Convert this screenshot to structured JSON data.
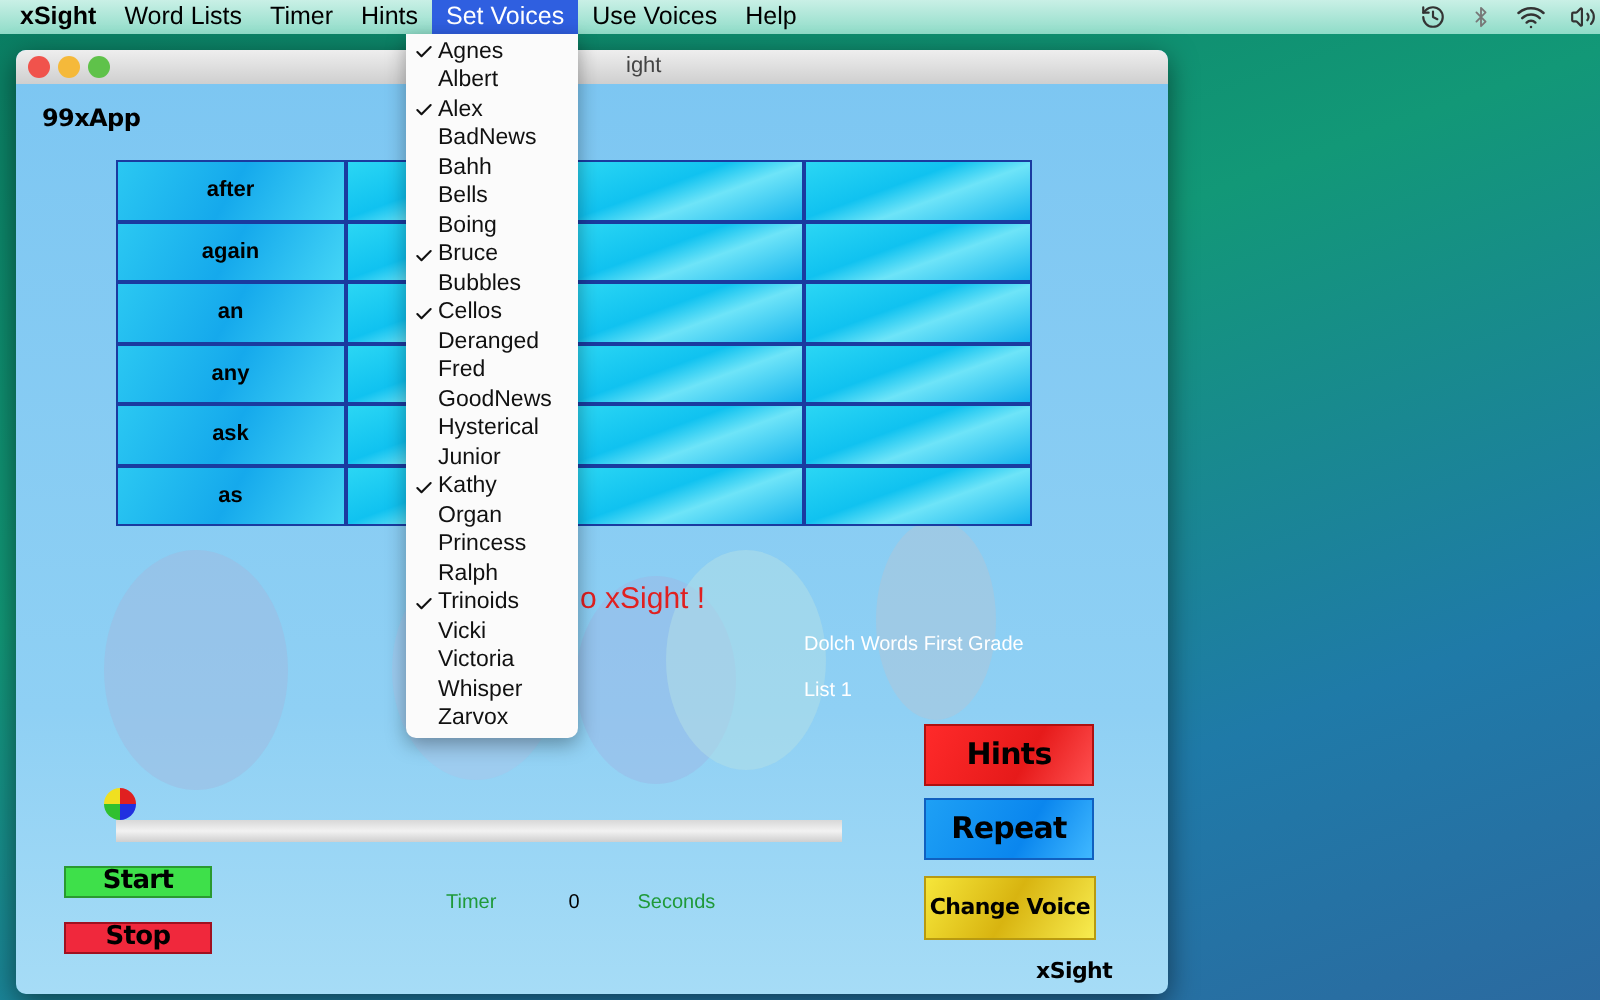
{
  "menu_bar": {
    "items": [
      {
        "label": "xSight",
        "selected": false,
        "kind": "app"
      },
      {
        "label": "Word Lists",
        "selected": false,
        "kind": "menu"
      },
      {
        "label": "Timer",
        "selected": false,
        "kind": "menu"
      },
      {
        "label": "Hints",
        "selected": false,
        "kind": "menu"
      },
      {
        "label": "Set Voices",
        "selected": true,
        "kind": "menu"
      },
      {
        "label": "Use Voices",
        "selected": false,
        "kind": "menu"
      },
      {
        "label": "Help",
        "selected": false,
        "kind": "menu"
      }
    ]
  },
  "voices_menu": {
    "items": [
      {
        "label": "Agnes",
        "checked": true
      },
      {
        "label": "Albert",
        "checked": false
      },
      {
        "label": "Alex",
        "checked": true
      },
      {
        "label": "BadNews",
        "checked": false
      },
      {
        "label": "Bahh",
        "checked": false
      },
      {
        "label": "Bells",
        "checked": false
      },
      {
        "label": "Boing",
        "checked": false
      },
      {
        "label": "Bruce",
        "checked": true
      },
      {
        "label": "Bubbles",
        "checked": false
      },
      {
        "label": "Cellos",
        "checked": true
      },
      {
        "label": "Deranged",
        "checked": false
      },
      {
        "label": "Fred",
        "checked": false
      },
      {
        "label": "GoodNews",
        "checked": false
      },
      {
        "label": "Hysterical",
        "checked": false
      },
      {
        "label": "Junior",
        "checked": false
      },
      {
        "label": "Kathy",
        "checked": true
      },
      {
        "label": "Organ",
        "checked": false
      },
      {
        "label": "Princess",
        "checked": false
      },
      {
        "label": "Ralph",
        "checked": false
      },
      {
        "label": "Trinoids",
        "checked": true
      },
      {
        "label": "Vicki",
        "checked": false
      },
      {
        "label": "Victoria",
        "checked": false
      },
      {
        "label": "Whisper",
        "checked": false
      },
      {
        "label": "Zarvox",
        "checked": false
      }
    ]
  },
  "window": {
    "title": "ight",
    "brand": "99xApp",
    "word_grid": {
      "rows": [
        "after",
        "again",
        "an",
        "any",
        "ask",
        "as"
      ]
    },
    "welcome": "o xSight !",
    "list_name": "Dolch Words First Grade",
    "list_number": "List 1",
    "progress": {
      "level": 0
    },
    "buttons": {
      "start": "Start",
      "stop": "Stop",
      "hints": "Hints",
      "repeat": "Repeat",
      "change_voice": "Change Voice"
    },
    "timer": {
      "label": "Timer",
      "value": "0",
      "unit": "Seconds"
    },
    "footer": "xSight"
  }
}
